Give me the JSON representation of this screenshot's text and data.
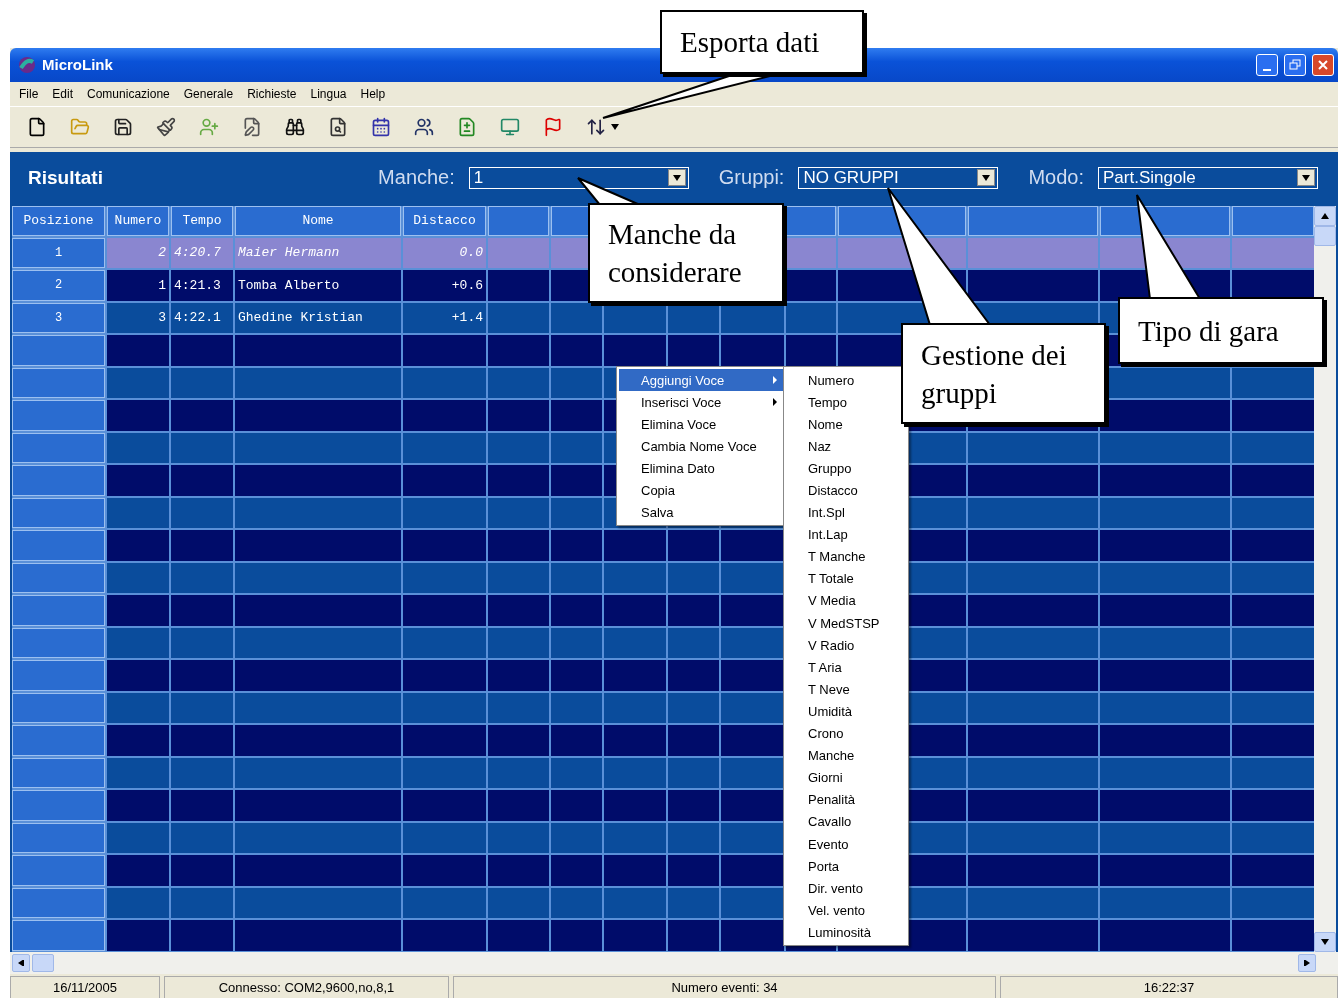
{
  "window": {
    "title": "MicroLink"
  },
  "menu": [
    "File",
    "Edit",
    "Comunicazione",
    "Generale",
    "Richieste",
    "Lingua",
    "Help"
  ],
  "panel": {
    "title": "Risultati",
    "filters": [
      {
        "label": "Manche:",
        "value": "1"
      },
      {
        "label": "Gruppi:",
        "value": "NO GRUPPI"
      },
      {
        "label": "Modo:",
        "value": "Part.Singole"
      }
    ]
  },
  "table": {
    "columns": [
      "Posizione",
      "Numero",
      "Tempo",
      "Nome",
      "Distacco"
    ],
    "rows": [
      {
        "cells": [
          "1",
          "2",
          "4:20.7",
          "Maier Hermann",
          "0.0"
        ],
        "selected": true
      },
      {
        "cells": [
          "2",
          "1",
          "4:21.3",
          "Tomba Alberto",
          "+0.6"
        ],
        "selected": false
      },
      {
        "cells": [
          "3",
          "3",
          "4:22.1",
          "Ghedine Kristian",
          "+1.4"
        ],
        "selected": false
      }
    ]
  },
  "context_menu": [
    {
      "label": "Aggiungi Voce",
      "submenu": true,
      "selected": true
    },
    {
      "label": "Inserisci Voce",
      "submenu": true,
      "selected": false
    },
    {
      "label": "Elimina Voce",
      "submenu": false,
      "selected": false
    },
    {
      "label": "Cambia Nome Voce",
      "submenu": false,
      "selected": false
    },
    {
      "label": "Elimina Dato",
      "submenu": false,
      "selected": false
    },
    {
      "label": "Copia",
      "submenu": false,
      "selected": false
    },
    {
      "label": "Salva",
      "submenu": false,
      "selected": false
    }
  ],
  "submenu": [
    "Numero",
    "Tempo",
    "Nome",
    "Naz",
    "Gruppo",
    "Distacco",
    "Int.Spl",
    "Int.Lap",
    "T Manche",
    "T Totale",
    "V Media",
    "V MedSTSP",
    "V Radio",
    "T Aria",
    "T Neve",
    "Umidità",
    "Crono",
    "Manche",
    "Giorni",
    "Penalità",
    "Cavallo",
    "Evento",
    "Porta",
    "Dir. vento",
    "Vel. vento",
    "Luminosità"
  ],
  "status_bar": [
    "16/11/2005",
    "Connesso: COM2,9600,no,8,1",
    "Numero eventi: 34",
    "16:22:37"
  ],
  "callouts": [
    {
      "text": "Esporta dati"
    },
    {
      "text": "Manche da considerare"
    },
    {
      "text": "Gestione dei gruppi"
    },
    {
      "text": "Tipo di gara"
    }
  ]
}
